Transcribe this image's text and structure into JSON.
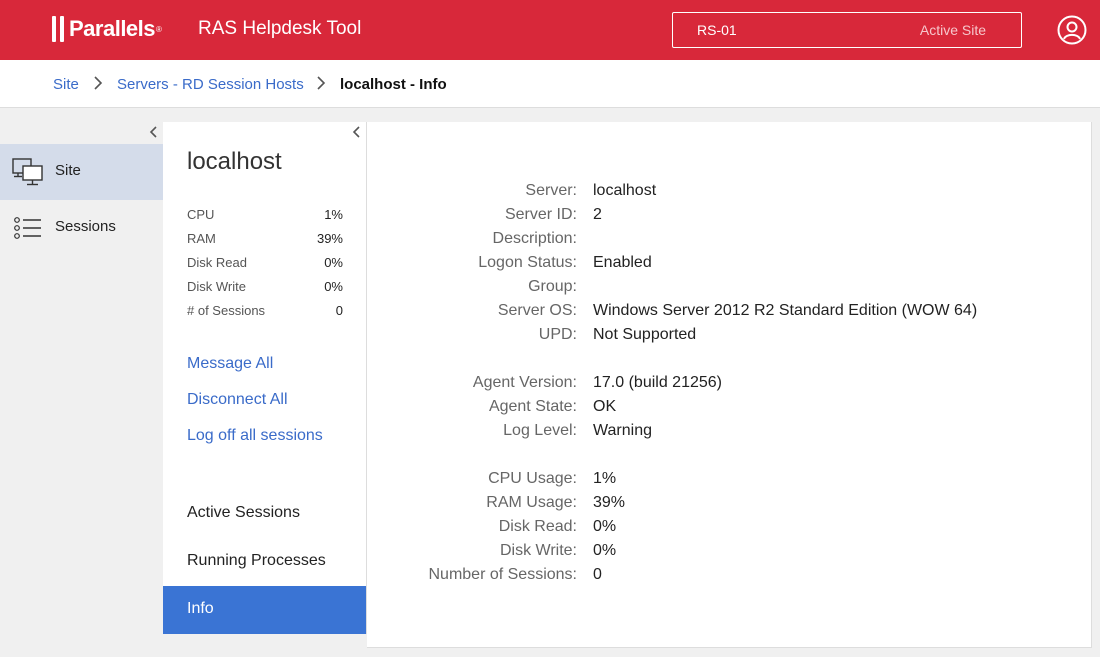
{
  "header": {
    "logo_text": "Parallels",
    "logo_mark": "®",
    "app_title": "RAS Helpdesk Tool",
    "site_name": "RS-01",
    "site_status": "Active Site",
    "user_icon": "user-circle-icon",
    "brand_color": "#d8283a"
  },
  "breadcrumb": {
    "items": [
      "Site",
      "Servers - RD Session Hosts"
    ],
    "current": "localhost - Info"
  },
  "leftnav": {
    "items": [
      {
        "label": "Site",
        "icon": "monitors-icon",
        "active": true
      },
      {
        "label": "Sessions",
        "icon": "list-icon",
        "active": false
      }
    ]
  },
  "host": {
    "name": "localhost",
    "stats": [
      {
        "label": "CPU",
        "value": "1%"
      },
      {
        "label": "RAM",
        "value": "39%"
      },
      {
        "label": "Disk Read",
        "value": "0%"
      },
      {
        "label": "Disk Write",
        "value": "0%"
      },
      {
        "label": "# of Sessions",
        "value": "0"
      }
    ],
    "actions": [
      "Message All",
      "Disconnect All",
      "Log off all sessions"
    ],
    "tabs": [
      {
        "label": "Active Sessions",
        "active": false
      },
      {
        "label": "Running Processes",
        "active": false
      },
      {
        "label": "Info",
        "active": true
      }
    ]
  },
  "info": {
    "groups": [
      [
        {
          "label": "Server:",
          "value": "localhost"
        },
        {
          "label": "Server ID:",
          "value": "2"
        },
        {
          "label": "Description:",
          "value": ""
        },
        {
          "label": "Logon Status:",
          "value": "Enabled"
        },
        {
          "label": "Group:",
          "value": ""
        },
        {
          "label": "Server OS:",
          "value": "Windows Server 2012 R2 Standard Edition (WOW 64)"
        },
        {
          "label": "UPD:",
          "value": "Not Supported"
        }
      ],
      [
        {
          "label": "Agent Version:",
          "value": "17.0 (build 21256)"
        },
        {
          "label": "Agent State:",
          "value": "OK"
        },
        {
          "label": "Log Level:",
          "value": "Warning"
        }
      ],
      [
        {
          "label": "CPU Usage:",
          "value": "1%"
        },
        {
          "label": "RAM Usage:",
          "value": "39%"
        },
        {
          "label": "Disk Read:",
          "value": "0%"
        },
        {
          "label": "Disk Write:",
          "value": "0%"
        },
        {
          "label": "Number of Sessions:",
          "value": "0"
        }
      ]
    ]
  }
}
